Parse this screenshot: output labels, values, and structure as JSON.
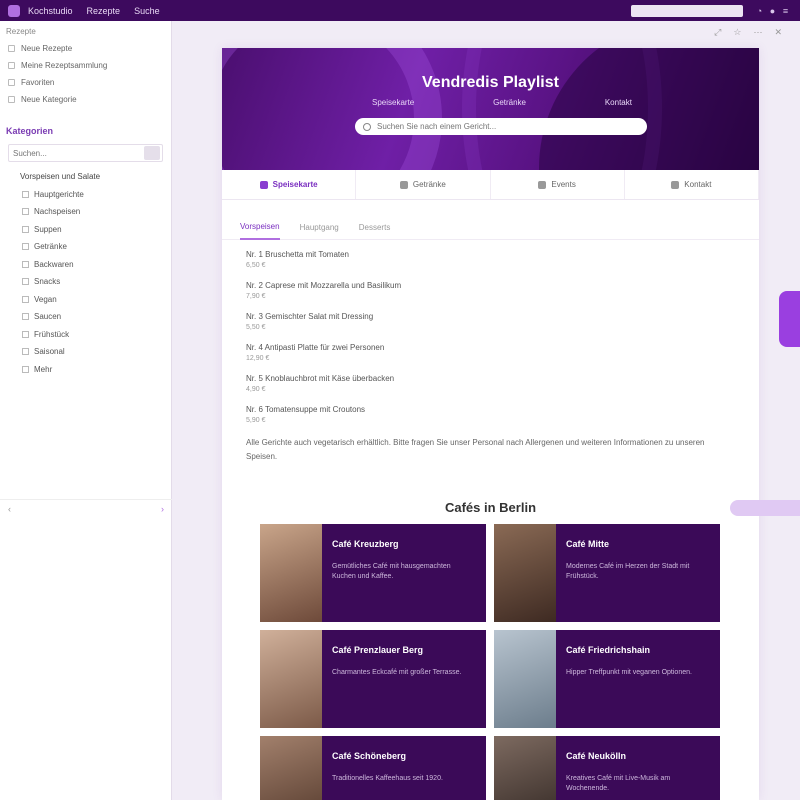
{
  "topbar": {
    "tabs": [
      "Kochstudio",
      "Rezepte",
      "Suche"
    ],
    "icons": [
      "bell-icon",
      "user-icon",
      "menu-icon"
    ]
  },
  "sidebar": {
    "title": "Rezepte",
    "links": [
      "Neue Rezepte",
      "Meine Rezeptsammlung",
      "Favoriten",
      "Neue Kategorie"
    ],
    "section_title": "Kategorien",
    "search_placeholder": "Suchen...",
    "items": [
      {
        "label": "Vorspeisen und Salate",
        "group": true
      },
      {
        "label": "Hauptgerichte",
        "group": false
      },
      {
        "label": "Nachspeisen",
        "group": false
      },
      {
        "label": "Suppen",
        "group": false
      },
      {
        "label": "Getränke",
        "group": false
      },
      {
        "label": "Backwaren",
        "group": false
      },
      {
        "label": "Snacks",
        "group": false
      },
      {
        "label": "Vegan",
        "group": false
      },
      {
        "label": "Saucen",
        "group": false
      },
      {
        "label": "Frühstück",
        "group": false
      },
      {
        "label": "Saisonal",
        "group": false
      },
      {
        "label": "Mehr",
        "group": false
      }
    ],
    "footer_prev": "‹",
    "footer_next": "›"
  },
  "page_tools": [
    "⤢",
    "☆",
    "⋯",
    "✕"
  ],
  "hero": {
    "title": "Vendredis Playlist",
    "nav": [
      "Speisekarte",
      "Getränke",
      "Kontakt"
    ],
    "search_placeholder": "Suchen Sie nach einem Gericht..."
  },
  "main_tabs": [
    {
      "label": "Speisekarte",
      "active": true
    },
    {
      "label": "Getränke",
      "active": false
    },
    {
      "label": "Events",
      "active": false
    },
    {
      "label": "Kontakt",
      "active": false
    }
  ],
  "sub_tabs": [
    {
      "label": "Vorspeisen",
      "active": true
    },
    {
      "label": "Hauptgang",
      "active": false
    },
    {
      "label": "Desserts",
      "active": false
    }
  ],
  "menu_items": [
    {
      "title": "Nr. 1 Bruschetta mit Tomaten",
      "price": "6,50 €"
    },
    {
      "title": "Nr. 2 Caprese mit Mozzarella und Basilikum",
      "price": "7,90 €"
    },
    {
      "title": "Nr. 3 Gemischter Salat mit Dressing",
      "price": "5,50 €"
    },
    {
      "title": "Nr. 4 Antipasti Platte für zwei Personen",
      "price": "12,90 €"
    },
    {
      "title": "Nr. 5 Knoblauchbrot mit Käse überbacken",
      "price": "4,90 €"
    },
    {
      "title": "Nr. 6 Tomatensuppe mit Croutons",
      "price": "5,90 €"
    }
  ],
  "menu_note": "Alle Gerichte auch vegetarisch erhältlich. Bitte fragen Sie unser Personal nach Allergenen und weiteren Informationen zu unseren Speisen.",
  "cafe_title": "Cafés in Berlin",
  "cards": [
    {
      "name": "Café Kreuzberg",
      "desc": "Gemütliches Café mit hausgemachten Kuchen und Kaffee.",
      "photo": [
        "#c9a58a",
        "#6e4a3a"
      ]
    },
    {
      "name": "Café Mitte",
      "desc": "Modernes Café im Herzen der Stadt mit Frühstück.",
      "photo": [
        "#8a6a55",
        "#3e2a22"
      ]
    },
    {
      "name": "Café Prenzlauer Berg",
      "desc": "Charmantes Eckcafé mit großer Terrasse.",
      "photo": [
        "#d0b09a",
        "#7c5a48"
      ]
    },
    {
      "name": "Café Friedrichshain",
      "desc": "Hipper Treffpunkt mit veganen Optionen.",
      "photo": [
        "#b8c4cf",
        "#6c7d8c"
      ]
    },
    {
      "name": "Café Schöneberg",
      "desc": "Traditionelles Kaffeehaus seit 1920.",
      "photo": [
        "#a2806c",
        "#4f3528"
      ]
    },
    {
      "name": "Café Neukölln",
      "desc": "Kreatives Café mit Live-Musik am Wochenende.",
      "photo": [
        "#7d6a60",
        "#2e2420"
      ]
    }
  ],
  "colors": {
    "brand": "#3d0a5e",
    "accent": "#9a3fe0",
    "card_bg": "#3b0a58"
  }
}
